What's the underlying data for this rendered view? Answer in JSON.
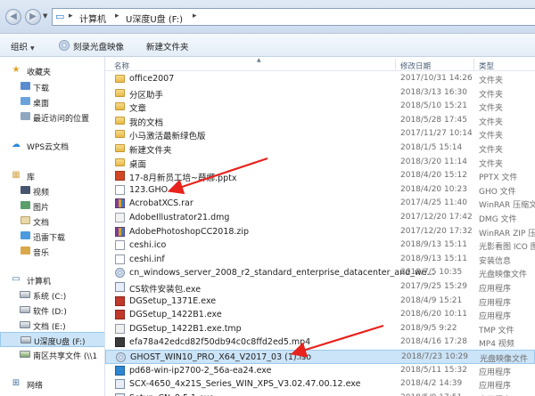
{
  "address": {
    "crumbs": [
      "计算机",
      "U深度U盘 (F:)"
    ]
  },
  "toolbar": {
    "organize": "组织",
    "burn": "刻录光盘映像",
    "new_folder": "新建文件夹"
  },
  "nav": {
    "favorites": "收藏夹",
    "downloads": "下载",
    "desktop": "桌面",
    "recent": "最近访问的位置",
    "wps_cloud": "WPS云文档",
    "library": "库",
    "videos": "视频",
    "pictures": "图片",
    "documents": "文档",
    "xunlei": "迅雷下载",
    "music": "音乐",
    "computer": "计算机",
    "drive_c": "系统 (C:)",
    "drive_d": "软件 (D:)",
    "drive_e": "文档 (E:)",
    "drive_f": "U深度U盘 (F:)",
    "drive_net": "南区共享文件 (\\\\1",
    "network": "网络"
  },
  "columns": {
    "name": "名称",
    "date": "修改日期",
    "type": "类型"
  },
  "files": [
    {
      "name": "office2007",
      "date": "2017/10/31 14:26",
      "type": "文件夹",
      "icon": "folder"
    },
    {
      "name": "分区助手",
      "date": "2018/3/13 16:30",
      "type": "文件夹",
      "icon": "folder"
    },
    {
      "name": "文章",
      "date": "2018/5/10 15:21",
      "type": "文件夹",
      "icon": "folder"
    },
    {
      "name": "我的文档",
      "date": "2018/5/28 17:45",
      "type": "文件夹",
      "icon": "folder"
    },
    {
      "name": "小马激活最新绿色版",
      "date": "2017/11/27 10:14",
      "type": "文件夹",
      "icon": "folder"
    },
    {
      "name": "新建文件夹",
      "date": "2018/1/5 15:14",
      "type": "文件夹",
      "icon": "folder"
    },
    {
      "name": "桌面",
      "date": "2018/3/20 11:14",
      "type": "文件夹",
      "icon": "folder"
    },
    {
      "name": "17-8月新员工培~薛娜.pptx",
      "date": "2018/4/20 15:12",
      "type": "PPTX 文件",
      "icon": "pptx"
    },
    {
      "name": "123.GHO",
      "date": "2018/4/20 10:23",
      "type": "GHO 文件",
      "icon": "gho"
    },
    {
      "name": "AcrobatXCS.rar",
      "date": "2017/4/25 11:40",
      "type": "WinRAR 压缩文",
      "icon": "rar"
    },
    {
      "name": "AdobeIllustrator21.dmg",
      "date": "2017/12/20 17:42",
      "type": "DMG 文件",
      "icon": "dmg"
    },
    {
      "name": "AdobePhotoshopCC2018.zip",
      "date": "2017/12/20 17:32",
      "type": "WinRAR ZIP 压",
      "icon": "rar"
    },
    {
      "name": "ceshi.ico",
      "date": "2018/9/13 15:11",
      "type": "光影看图 ICO 图",
      "icon": "ico"
    },
    {
      "name": "ceshi.inf",
      "date": "2018/9/13 15:11",
      "type": "安装信息",
      "icon": "inf"
    },
    {
      "name": "cn_windows_server_2008_r2_standard_enterprise_datacenter_and_we...",
      "date": "2018/7/5 10:35",
      "type": "光盘映像文件",
      "icon": "iso"
    },
    {
      "name": "CS软件安装包.exe",
      "date": "2017/9/25 15:29",
      "type": "应用程序",
      "icon": "exe"
    },
    {
      "name": "DGSetup_1371E.exe",
      "date": "2018/4/9 15:21",
      "type": "应用程序",
      "icon": "exe-red"
    },
    {
      "name": "DGSetup_1422B1.exe",
      "date": "2018/6/20 10:11",
      "type": "应用程序",
      "icon": "exe-red"
    },
    {
      "name": "DGSetup_1422B1.exe.tmp",
      "date": "2018/9/5 9:22",
      "type": "TMP 文件",
      "icon": "tmp"
    },
    {
      "name": "efa78a42edcd82f50db94c0c8ffd2ed5.mp4",
      "date": "2018/4/16 17:28",
      "type": "MP4 视频",
      "icon": "mp4"
    },
    {
      "name": "GHOST_WIN10_PRO_X64_V2017_03 (1).iso",
      "date": "2018/7/23 10:29",
      "type": "光盘映像文件",
      "icon": "iso",
      "selected": true
    },
    {
      "name": "pd68-win-ip2700-2_56a-ea24.exe",
      "date": "2018/5/11 15:32",
      "type": "应用程序",
      "icon": "exe-blue"
    },
    {
      "name": "SCX-4650_4x21S_Series_WIN_XPS_V3.02.47.00.12.exe",
      "date": "2018/4/2 14:39",
      "type": "应用程序",
      "icon": "exe"
    },
    {
      "name": "Setup_CN_8.5.1.exe",
      "date": "2018/5/9 17:51",
      "type": "应用程序",
      "icon": "exe"
    }
  ],
  "icons": {
    "back": "arrow-left-icon",
    "forward": "arrow-right-icon",
    "folder": "folder-icon",
    "annotation": "red-arrow"
  },
  "colors": {
    "selection": "#cce4f7",
    "annotation_arrow": "#e8221c"
  }
}
